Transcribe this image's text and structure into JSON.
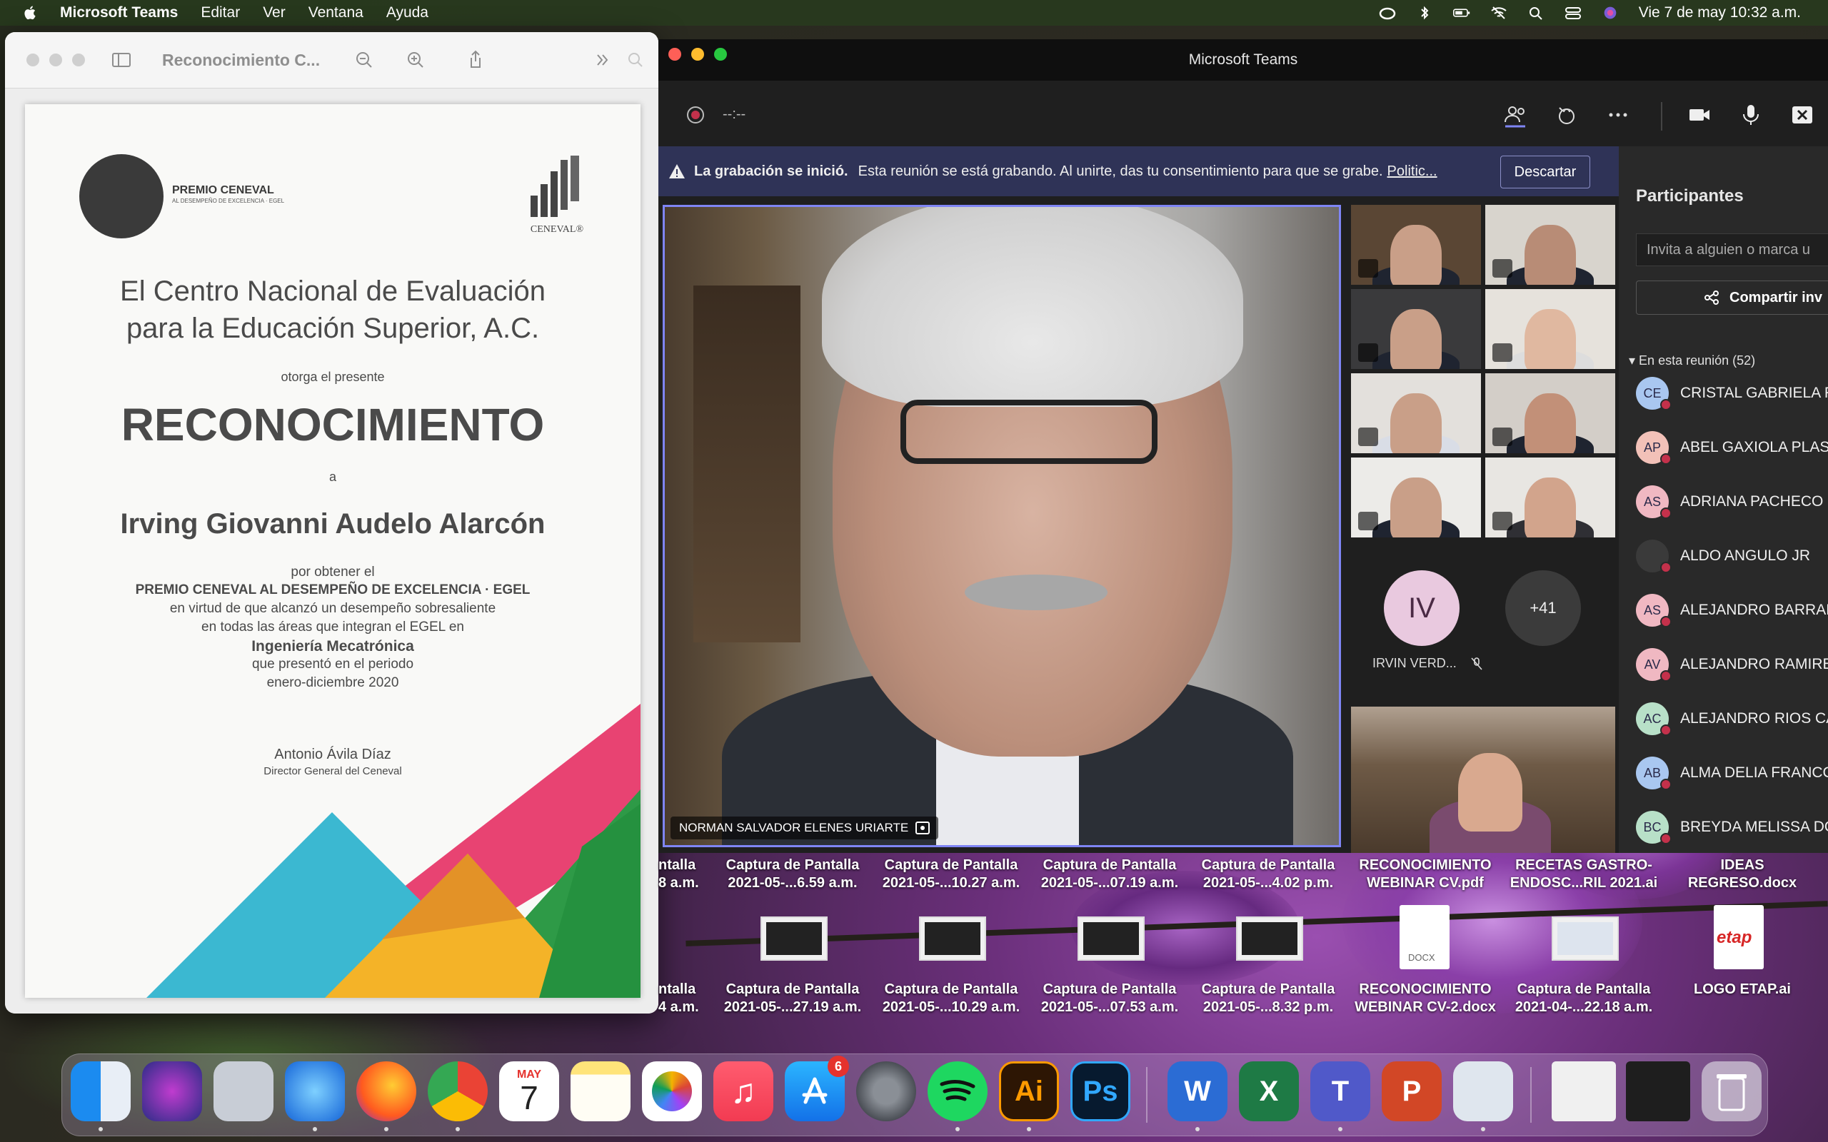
{
  "menubar": {
    "app": "Microsoft Teams",
    "items": [
      "Editar",
      "Ver",
      "Ventana",
      "Ayuda"
    ],
    "clock": "Vie 7 de may  10:32 a.m."
  },
  "preview": {
    "title": "Reconocimiento C...",
    "certificate": {
      "logo_left_title": "PREMIO CENEVAL",
      "logo_left_sub": "AL DESEMPEÑO DE EXCELENCIA · EGEL",
      "logo_right": "CENEVAL®",
      "org_line1": "El Centro Nacional de Evaluación",
      "org_line2": "para la Educación Superior, A.C.",
      "grants": "otorga el presente",
      "heading": "RECONOCIMIENTO",
      "to": "a",
      "recipient": "Irving Giovanni Audelo Alarcón",
      "body1": "por obtener el",
      "body2": "PREMIO CENEVAL AL DESEMPEÑO DE EXCELENCIA · EGEL",
      "body3": "en virtud de que alcanzó un desempeño sobresaliente",
      "body4": "en todas las áreas que integran el EGEL en",
      "program": "Ingeniería Mecatrónica",
      "body5": "que presentó en el periodo",
      "period": "enero-diciembre 2020",
      "signer": "Antonio Ávila Díaz",
      "signer_title": "Director General del Ceneval"
    }
  },
  "teams": {
    "title": "Microsoft Teams",
    "rec_time": "--:--",
    "banner": {
      "strong": "La grabación se inició.",
      "text": "Esta reunión se está grabando. Al unirte, das tu consentimiento para que se grabe.",
      "link": "Politic...",
      "dismiss": "Descartar"
    },
    "speaker_name": "NORMAN SALVADOR ELENES URIARTE",
    "avatar_initials": "IV",
    "avatar_name": "IRVIN VERD...",
    "overflow_count": "+41",
    "panel": {
      "title": "Participantes",
      "invite_placeholder": "Invita a alguien o marca u",
      "share": "Compartir inv",
      "section": "En esta reunión (52)",
      "participants": [
        {
          "initials": "CE",
          "name": "CRISTAL GABRIELA R",
          "color": "#a9c7f0"
        },
        {
          "initials": "AP",
          "name": "ABEL GAXIOLA PLASC",
          "color": "#f2c1b8"
        },
        {
          "initials": "AS",
          "name": "ADRIANA PACHECO",
          "color": "#f0b8c2"
        },
        {
          "initials": "",
          "name": "ALDO ANGULO JR",
          "color": "#3a3a3a"
        },
        {
          "initials": "AS",
          "name": "ALEJANDRO BARRAN",
          "color": "#f0b8c2"
        },
        {
          "initials": "AV",
          "name": "ALEJANDRO RAMIRE",
          "color": "#f0b8c2"
        },
        {
          "initials": "AC",
          "name": "ALEJANDRO RIOS CA",
          "color": "#b8e0c8"
        },
        {
          "initials": "AB",
          "name": "ALMA DELIA FRANCC",
          "color": "#a9c7f0"
        },
        {
          "initials": "BC",
          "name": "BREYDA MELISSA DO",
          "color": "#b8e0c8"
        }
      ]
    }
  },
  "desktop": {
    "row1": [
      {
        "l1": "ntalla",
        "l2": "8 a.m."
      },
      {
        "l1": "Captura de Pantalla",
        "l2": "2021-05-...6.59 a.m."
      },
      {
        "l1": "Captura de Pantalla",
        "l2": "2021-05-...10.27 a.m."
      },
      {
        "l1": "Captura de Pantalla",
        "l2": "2021-05-...07.19 a.m."
      },
      {
        "l1": "Captura de Pantalla",
        "l2": "2021-05-...4.02 p.m."
      },
      {
        "l1": "RECONOCIMIENTO",
        "l2": "WEBINAR CV.pdf"
      },
      {
        "l1": "RECETAS GASTRO-",
        "l2": "ENDOSC...RIL 2021.ai"
      },
      {
        "l1": "IDEAS",
        "l2": "REGRESO.docx"
      }
    ],
    "row2": [
      {
        "l1": "ntalla",
        "l2": "4 a.m."
      },
      {
        "l1": "Captura de Pantalla",
        "l2": "2021-05-...27.19 a.m."
      },
      {
        "l1": "Captura de Pantalla",
        "l2": "2021-05-...10.29 a.m."
      },
      {
        "l1": "Captura de Pantalla",
        "l2": "2021-05-...07.53 a.m."
      },
      {
        "l1": "Captura de Pantalla",
        "l2": "2021-05-...8.32 p.m."
      },
      {
        "l1": "RECONOCIMIENTO",
        "l2": "WEBINAR CV-2.docx"
      },
      {
        "l1": "Captura de Pantalla",
        "l2": "2021-04-...22.18 a.m."
      },
      {
        "l1": "LOGO ETAP.ai",
        "l2": ""
      }
    ],
    "docx_label": "DOCX",
    "etap_label": "etap"
  },
  "dock": {
    "calendar_month": "MAY",
    "calendar_day": "7",
    "appstore_badge": "6",
    "ai_label": "Ai",
    "ps_label": "Ps",
    "word_label": "W",
    "excel_label": "X",
    "teams_label": "T",
    "ppt_label": "P"
  }
}
